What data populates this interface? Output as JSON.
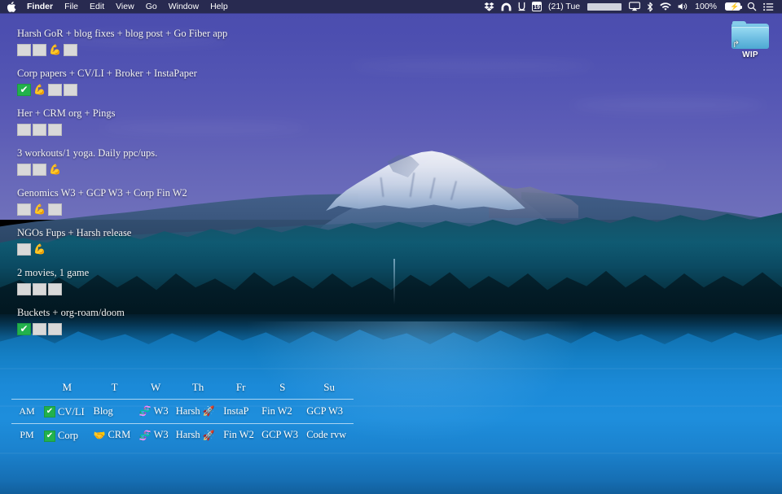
{
  "menubar": {
    "apple_icon": "apple-logo",
    "app_menus": [
      {
        "label": "Finder",
        "bold": true
      },
      {
        "label": "File",
        "bold": false
      },
      {
        "label": "Edit",
        "bold": false
      },
      {
        "label": "View",
        "bold": false
      },
      {
        "label": "Go",
        "bold": false
      },
      {
        "label": "Window",
        "bold": false
      },
      {
        "label": "Help",
        "bold": false
      }
    ],
    "status_items": [
      {
        "name": "dropbox-icon",
        "glyph": "❦",
        "type": "icon"
      },
      {
        "name": "arc-browser-icon",
        "glyph": "◠",
        "type": "icon"
      },
      {
        "name": "unicorn-app-icon",
        "glyph": "U",
        "type": "icon"
      },
      {
        "name": "calendar-icon",
        "glyph": "19",
        "type": "calendar"
      },
      {
        "name": "day-counter-text",
        "glyph": "(21) Tue",
        "type": "text"
      },
      {
        "name": "redacted-clock",
        "glyph": "",
        "type": "redacted"
      },
      {
        "name": "airplay-icon",
        "glyph": "▭",
        "type": "icon"
      },
      {
        "name": "bluetooth-icon",
        "glyph": "ᛦ",
        "type": "icon"
      },
      {
        "name": "wifi-icon",
        "glyph": "◕",
        "type": "icon"
      },
      {
        "name": "volume-icon",
        "glyph": "◁",
        "type": "icon"
      },
      {
        "name": "battery-percent-text",
        "glyph": "100%",
        "type": "text"
      },
      {
        "name": "battery-icon",
        "glyph": "⚡",
        "type": "battery"
      },
      {
        "name": "spotlight-search-icon",
        "glyph": "⚲",
        "type": "icon"
      },
      {
        "name": "notification-center-icon",
        "glyph": "≡",
        "type": "icon"
      }
    ]
  },
  "desktop_icons": [
    {
      "name": "wip-folder",
      "label": "WIP",
      "kind": "folder-alias",
      "color": "#6dbde2"
    }
  ],
  "tasklist": {
    "groups": [
      {
        "title": "Harsh GoR + blog fixes + blog post + Go Fiber app",
        "boxes": [
          {
            "state": "empty",
            "glyph": ""
          },
          {
            "state": "empty",
            "glyph": ""
          },
          {
            "state": "emoji",
            "glyph": "💪"
          },
          {
            "state": "empty",
            "glyph": ""
          }
        ]
      },
      {
        "title": "Corp papers + CV/LI + Broker + InstaPaper",
        "boxes": [
          {
            "state": "checked",
            "glyph": "✔"
          },
          {
            "state": "emoji",
            "glyph": "💪"
          },
          {
            "state": "empty",
            "glyph": ""
          },
          {
            "state": "empty",
            "glyph": ""
          }
        ]
      },
      {
        "title": "Her + CRM org + Pings",
        "boxes": [
          {
            "state": "empty",
            "glyph": ""
          },
          {
            "state": "empty",
            "glyph": ""
          },
          {
            "state": "empty",
            "glyph": ""
          }
        ]
      },
      {
        "title": "3 workouts/1 yoga. Daily ppc/ups.",
        "boxes": [
          {
            "state": "empty",
            "glyph": ""
          },
          {
            "state": "empty",
            "glyph": ""
          },
          {
            "state": "emoji",
            "glyph": "💪"
          }
        ]
      },
      {
        "title": "Genomics W3 + GCP W3 + Corp Fin W2",
        "boxes": [
          {
            "state": "empty",
            "glyph": ""
          },
          {
            "state": "emoji",
            "glyph": "💪"
          },
          {
            "state": "empty",
            "glyph": ""
          }
        ]
      },
      {
        "title": "NGOs Fups + Harsh release",
        "boxes": [
          {
            "state": "empty",
            "glyph": ""
          },
          {
            "state": "emoji",
            "glyph": "💪"
          }
        ]
      },
      {
        "title": "2 movies, 1 game",
        "boxes": [
          {
            "state": "empty",
            "glyph": ""
          },
          {
            "state": "empty",
            "glyph": ""
          },
          {
            "state": "empty",
            "glyph": ""
          }
        ]
      },
      {
        "title": "Buckets + org-roam/doom",
        "boxes": [
          {
            "state": "checked",
            "glyph": "✔"
          },
          {
            "state": "empty",
            "glyph": ""
          },
          {
            "state": "empty",
            "glyph": ""
          }
        ]
      }
    ]
  },
  "week_table": {
    "corner_label": "",
    "day_headers": [
      "M",
      "T",
      "W",
      "Th",
      "Fr",
      "S",
      "Su"
    ],
    "rows": [
      {
        "label": "AM",
        "cells": [
          {
            "check": true,
            "emoji": "",
            "text": "CV/LI"
          },
          {
            "check": false,
            "emoji": "",
            "text": "Blog"
          },
          {
            "check": false,
            "emoji": "🧬",
            "text": "W3"
          },
          {
            "check": false,
            "emoji": "🚀",
            "text": "Harsh",
            "emoji_after": true
          },
          {
            "check": false,
            "emoji": "",
            "text": "InstaP"
          },
          {
            "check": false,
            "emoji": "",
            "text": "Fin W2"
          },
          {
            "check": false,
            "emoji": "",
            "text": "GCP W3"
          }
        ]
      },
      {
        "label": "PM",
        "cells": [
          {
            "check": true,
            "emoji": "",
            "text": "Corp"
          },
          {
            "check": false,
            "emoji": "🤝",
            "text": "CRM"
          },
          {
            "check": false,
            "emoji": "🧬",
            "text": "W3"
          },
          {
            "check": false,
            "emoji": "🚀",
            "text": "Harsh",
            "emoji_after": true
          },
          {
            "check": false,
            "emoji": "",
            "text": "Fin W2"
          },
          {
            "check": false,
            "emoji": "",
            "text": "GCP W3"
          },
          {
            "check": false,
            "emoji": "",
            "text": "Code rvw"
          }
        ]
      }
    ]
  },
  "colors": {
    "menubar_bg": "#282a50",
    "sky": "#4a4cae",
    "lake": "#1b8ad8",
    "forest": "#0f5a72",
    "checkbox_green": "#22b14c",
    "folder_blue": "#6dbde2"
  }
}
